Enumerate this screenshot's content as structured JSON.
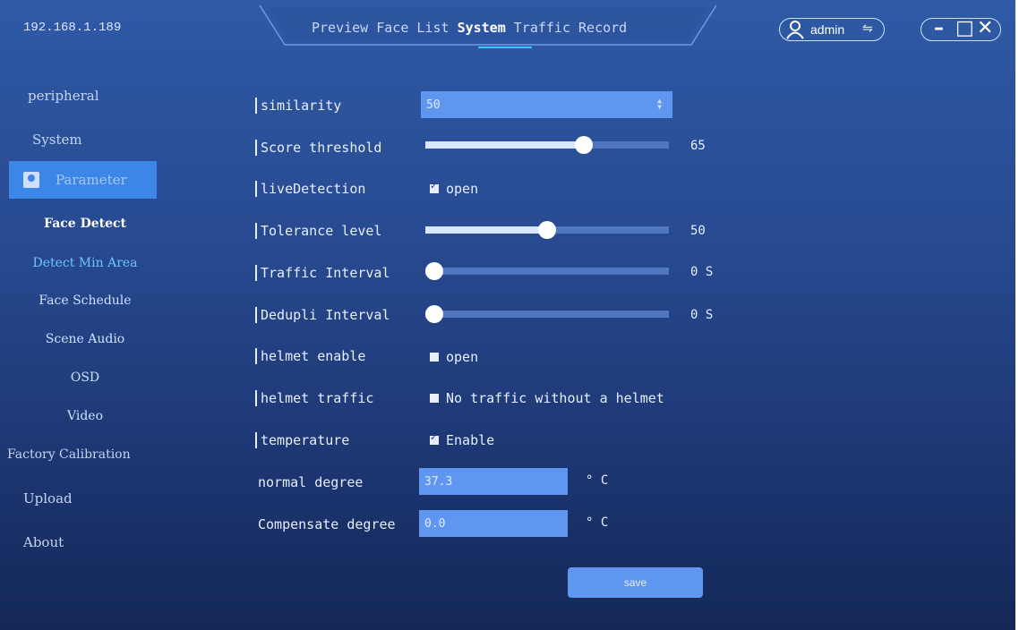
{
  "header": {
    "ip": "192.168.1.189",
    "tabs": [
      {
        "label": "Preview",
        "active": false
      },
      {
        "label": "Face List",
        "active": false
      },
      {
        "label": "System",
        "active": true
      },
      {
        "label": "Traffic Record",
        "active": false
      }
    ],
    "user": "admin",
    "swap_glyph": "⇋",
    "min_glyph": "–",
    "max_glyph": "□",
    "close_glyph": "✕"
  },
  "sidebar": {
    "items": [
      "peripheral",
      "System",
      "Parameter"
    ],
    "subitems": [
      "Face Detect",
      "Detect Min Area",
      "Face Schedule",
      "Scene Audio",
      "OSD",
      "Video"
    ],
    "items2": [
      "Factory Calibration",
      "Upload",
      "About"
    ]
  },
  "form": {
    "similarity": {
      "label": "similarity",
      "value": "50"
    },
    "score": {
      "label": "Score threshold",
      "value": 65,
      "display": "65"
    },
    "live": {
      "label": "liveDetection",
      "option": "open",
      "checked": true
    },
    "tolerance": {
      "label": "Tolerance level",
      "value": 50,
      "display": "50"
    },
    "traffic_interval": {
      "label": "Traffic Interval",
      "value": 0,
      "display": "0 S"
    },
    "dedupli_interval": {
      "label": "Dedupli Interval",
      "value": 0,
      "display": "0 S"
    },
    "helmet_enable": {
      "label": "helmet enable",
      "option": "open",
      "checked": false
    },
    "helmet_traffic": {
      "label": "helmet traffic",
      "option": "No traffic without a helmet",
      "checked": false
    },
    "temperature": {
      "label": "temperature",
      "option": "Enable",
      "checked": true
    },
    "normal_degree": {
      "label": "normal degree",
      "value": "37.3",
      "unit": "° C"
    },
    "compensate_degree": {
      "label": "Compensate degree",
      "value": "0.0",
      "unit": "° C"
    },
    "save": "save"
  },
  "colors": {
    "accent": "#3b86e6",
    "input": "#5f97f0",
    "bg_top": "#2f5aa6",
    "bg_bottom": "#142858"
  }
}
